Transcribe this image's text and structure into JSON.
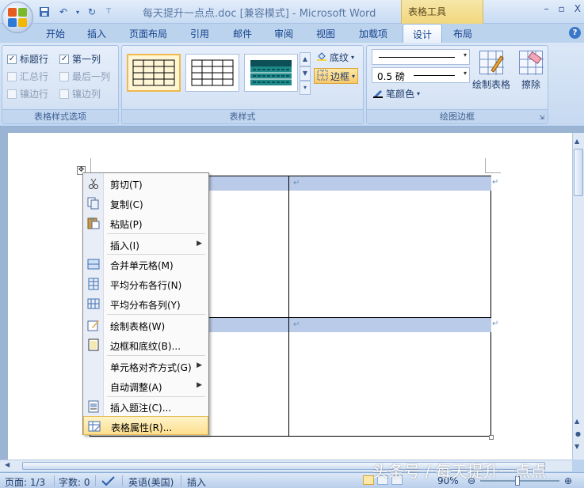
{
  "window": {
    "title": "每天提升一点点.doc [兼容模式] - Microsoft Word",
    "contextual_tab_group": "表格工具",
    "controls": [
      "–",
      "▫",
      "X"
    ]
  },
  "ribbon_tabs": [
    "开始",
    "插入",
    "页面布局",
    "引用",
    "邮件",
    "审阅",
    "视图",
    "加载项",
    "设计",
    "布局"
  ],
  "active_tab": "设计",
  "groups": {
    "style_options": {
      "label": "表格样式选项",
      "options": [
        {
          "label": "标题行",
          "checked": true,
          "enabled": true
        },
        {
          "label": "第一列",
          "checked": true,
          "enabled": true
        },
        {
          "label": "汇总行",
          "checked": false,
          "enabled": false
        },
        {
          "label": "最后一列",
          "checked": false,
          "enabled": false
        },
        {
          "label": "镶边行",
          "checked": false,
          "enabled": false
        },
        {
          "label": "镶边列",
          "checked": false,
          "enabled": false
        }
      ]
    },
    "table_styles": {
      "label": "表样式",
      "shading_label": "底纹",
      "borders_label": "边框"
    },
    "draw_borders": {
      "label": "绘图边框",
      "line_weight": "0.5 磅",
      "pen_color_label": "笔颜色",
      "draw_table_label": "绘制表格",
      "eraser_label": "擦除"
    }
  },
  "context_menu": {
    "items": [
      {
        "label": "剪切(T)",
        "icon": "scissors-icon"
      },
      {
        "label": "复制(C)",
        "icon": "copy-icon"
      },
      {
        "label": "粘贴(P)",
        "icon": "paste-icon"
      },
      {
        "label": "插入(I)",
        "icon": "",
        "submenu": true
      },
      {
        "label": "合并单元格(M)",
        "icon": "merge-cells-icon"
      },
      {
        "label": "平均分布各行(N)",
        "icon": "distribute-rows-icon"
      },
      {
        "label": "平均分布各列(Y)",
        "icon": "distribute-columns-icon"
      },
      {
        "label": "绘制表格(W)",
        "icon": "draw-table-icon"
      },
      {
        "label": "边框和底纹(B)...",
        "icon": "borders-shading-icon"
      },
      {
        "label": "单元格对齐方式(G)",
        "icon": "",
        "submenu": true
      },
      {
        "label": "自动调整(A)",
        "icon": "",
        "submenu": true
      },
      {
        "label": "插入题注(C)...",
        "icon": "caption-icon"
      },
      {
        "label": "表格属性(R)...",
        "icon": "table-properties-icon",
        "highlighted": true
      }
    ]
  },
  "statusbar": {
    "page": "页面: 1/3",
    "words": "字数: 0",
    "language": "英语(美国)",
    "mode": "插入",
    "zoom": "90%"
  },
  "watermark": "头条号 / 每天提升一点点",
  "colors": {
    "ribbon_bg": "#dbe7f7",
    "tools_tab": "#f1d77d",
    "selection": "#b9cbe8",
    "menu_highlight": "#fddf8f"
  }
}
